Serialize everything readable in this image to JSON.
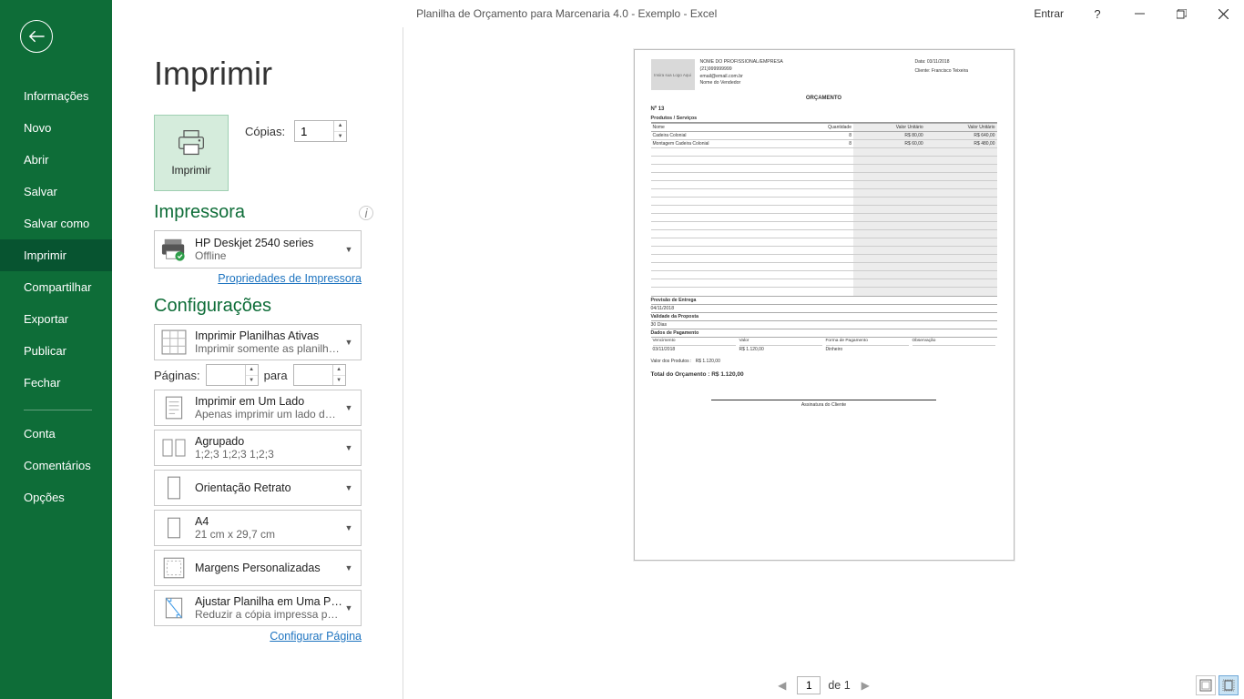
{
  "title": "Planilha de Orçamento para Marcenaria 4.0 - Exemplo  -  Excel",
  "signin": "Entrar",
  "sidebar": {
    "items": [
      "Informações",
      "Novo",
      "Abrir",
      "Salvar",
      "Salvar como",
      "Imprimir",
      "Compartilhar",
      "Exportar",
      "Publicar",
      "Fechar"
    ],
    "items2": [
      "Conta",
      "Comentários",
      "Opções"
    ],
    "selected_index": 5
  },
  "print": {
    "heading": "Imprimir",
    "button": "Imprimir",
    "copies_label": "Cópias:",
    "copies_value": "1",
    "printer_heading": "Impressora",
    "printer_name": "HP Deskjet 2540 series",
    "printer_status": "Offline",
    "printer_props": "Propriedades de Impressora",
    "settings_heading": "Configurações",
    "setting_sheets": {
      "l1": "Imprimir Planilhas Ativas",
      "l2": "Imprimir somente as planilh…"
    },
    "pages_label": "Páginas:",
    "pages_to": "para",
    "setting_side": {
      "l1": "Imprimir em Um Lado",
      "l2": "Apenas imprimir um lado d…"
    },
    "setting_collate": {
      "l1": "Agrupado",
      "l2": "1;2;3    1;2;3    1;2;3"
    },
    "setting_orient": {
      "l1": "Orientação Retrato"
    },
    "setting_paper": {
      "l1": "A4",
      "l2": "21 cm x 29,7 cm"
    },
    "setting_margins": {
      "l1": "Margens Personalizadas"
    },
    "setting_scale": {
      "l1": "Ajustar Planilha em Uma Pá…",
      "l2": "Reduzir a cópia impressa pa…"
    },
    "page_setup": "Configurar Página"
  },
  "nav": {
    "page": "1",
    "of": "de 1"
  },
  "doc": {
    "logo": "Insira sua Logo Aqui",
    "company": "NOME DO PROFISSIONAL/EMPRESA",
    "phone": "(21)999999999",
    "email": "email@email.com.br",
    "seller": "Nome do Vendedor",
    "date_label": "Data:",
    "date": "03/11/2018",
    "client_label": "Cliente:",
    "client": "Francisco Teixeira",
    "title": "ORÇAMENTO",
    "number": "Nº 13",
    "section_products": "Produtos / Serviços",
    "cols": [
      "Nome",
      "Quantidade",
      "Valor Unitário",
      "Valor Unitário"
    ],
    "rows": [
      [
        "Cadeira Colonial",
        "8",
        "R$ 80,00",
        "R$ 640,00"
      ],
      [
        "Montagem Cadeira Colonial",
        "8",
        "R$ 60,00",
        "R$ 480,00"
      ]
    ],
    "empty_rows": 18,
    "delivery_label": "Previsão de Entrega",
    "delivery": "04/11/2018",
    "validity_label": "Validade da Proposta",
    "validity": "30 Dias",
    "pay_section": "Dados de Pagamento",
    "pay_cols": [
      "Vencimento",
      "Valor",
      "Forma de Pagamento",
      "Observação"
    ],
    "pay_vals": [
      "03/11/2018",
      "R$ 1.120,00",
      "Dinheiro",
      ""
    ],
    "products_value_label": "Valor dos Produtos :",
    "products_value": "R$ 1.120,00",
    "total_label": "Total do Orçamento :",
    "total": "R$ 1.120,00",
    "signature": "Assinatura do Cliente"
  }
}
